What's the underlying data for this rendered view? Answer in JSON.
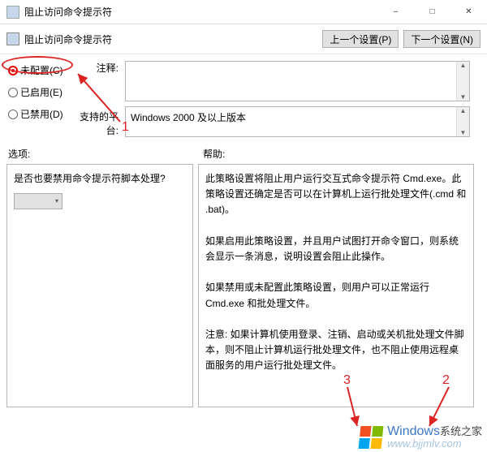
{
  "window": {
    "title": "阻止访问命令提示符"
  },
  "header": {
    "title": "阻止访问命令提示符",
    "prev_button": "上一个设置(P)",
    "next_button": "下一个设置(N)"
  },
  "radios": {
    "not_configured": "未配置(C)",
    "enabled": "已启用(E)",
    "disabled": "已禁用(D)"
  },
  "comment": {
    "label": "注释:",
    "value": ""
  },
  "platform": {
    "label": "支持的平台:",
    "value": "Windows 2000 及以上版本"
  },
  "section_labels": {
    "options": "选项:",
    "help": "帮助:"
  },
  "options_panel": {
    "question": "是否也要禁用命令提示符脚本处理?",
    "dropdown_value": ""
  },
  "help_text": {
    "p1": "此策略设置将阻止用户运行交互式命令提示符 Cmd.exe。此策略设置还确定是否可以在计算机上运行批处理文件(.cmd 和 .bat)。",
    "p2": "如果启用此策略设置，并且用户试图打开命令窗口，则系统会显示一条消息，说明设置会阻止此操作。",
    "p3": "如果禁用或未配置此策略设置，则用户可以正常运行 Cmd.exe 和批处理文件。",
    "p4": "注意: 如果计算机使用登录、注销、启动或关机批处理文件脚本，则不阻止计算机运行批处理文件，也不阻止使用远程桌面服务的用户运行批处理文件。"
  },
  "annotations": {
    "n1": "1",
    "n2": "2",
    "n3": "3"
  },
  "watermark": {
    "brand": "Windows",
    "sub": "系统之家",
    "url": "www.bjjmlv.com"
  }
}
